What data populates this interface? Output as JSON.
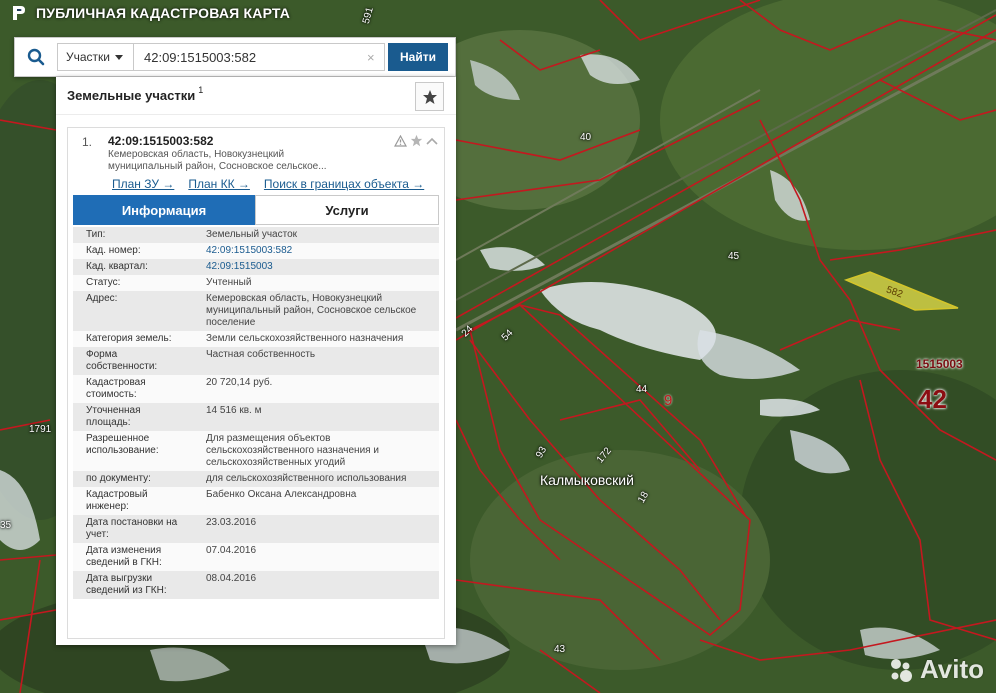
{
  "app": {
    "title": "ПУБЛИЧНАЯ КАДАСТРОВАЯ КАРТА",
    "logo_icon": "pkk-logo-icon"
  },
  "search": {
    "type_label": "Участки",
    "value": "42:09:1515003:582",
    "clear_symbol": "×",
    "button_label": "Найти"
  },
  "results": {
    "title": "Земельные участки",
    "count": "1",
    "item": {
      "index": "1.",
      "number": "42:09:1515003:582",
      "address_line1": "Кемеровская область, Новокузнецкий",
      "address_line2": "муниципальный район, Сосновское сельское...",
      "links": [
        "План ЗУ →",
        "План КК →",
        "Поиск в границах объекта →"
      ],
      "tabs": [
        "Информация",
        "Услуги"
      ],
      "fields": [
        {
          "k": "Тип:",
          "v": "Земельный участок"
        },
        {
          "k": "Кад. номер:",
          "v": "42:09:1515003:582"
        },
        {
          "k": "Кад. квартал:",
          "v": "42:09:1515003"
        },
        {
          "k": "Статус:",
          "v": "Учтенный"
        },
        {
          "k": "Адрес:",
          "v": "Кемеровская область, Новокузнецкий муниципальный район, Сосновское сельское поселение"
        },
        {
          "k": "Категория земель:",
          "v": "Земли сельскохозяйственного назначения"
        },
        {
          "k": "Форма собственности:",
          "v": "Частная собственность"
        },
        {
          "k": "Кадастровая стоимость:",
          "v": "20 720,14 руб."
        },
        {
          "k": "Уточненная площадь:",
          "v": "14 516 кв. м"
        },
        {
          "k": "Разрешенное использование:",
          "v": "Для размещения объектов сельскохозяйственного назначения и сельскохозяйственных угодий"
        },
        {
          "k": "по документу:",
          "v": "для сельскохозяйственного использования"
        },
        {
          "k": "Кадастровый инженер:",
          "v": "Бабенко Оксана Александровна"
        },
        {
          "k": "Дата постановки на учет:",
          "v": "23.03.2016"
        },
        {
          "k": "Дата изменения сведений в ГКН:",
          "v": "07.04.2016"
        },
        {
          "k": "Дата выгрузки сведений из ГКН:",
          "v": "08.04.2016"
        }
      ]
    }
  },
  "map": {
    "labels": {
      "l591": "591",
      "l40": "40",
      "l45": "45",
      "l582": "582",
      "l1515003": "1515003",
      "l42": "42",
      "l44": "44",
      "l9": "9",
      "l54": "54",
      "l24": "24",
      "l1791": "1791",
      "l35": "35",
      "l93": "93",
      "l172": "172",
      "l18": "18",
      "l43": "43",
      "place": "Калмыковский"
    }
  },
  "watermark": {
    "text": "Avito"
  },
  "colors": {
    "accent": "#1f6db6",
    "search_button": "#1a5b8f",
    "parcel_border": "#c4181f",
    "highlight": "#e8e14a"
  }
}
